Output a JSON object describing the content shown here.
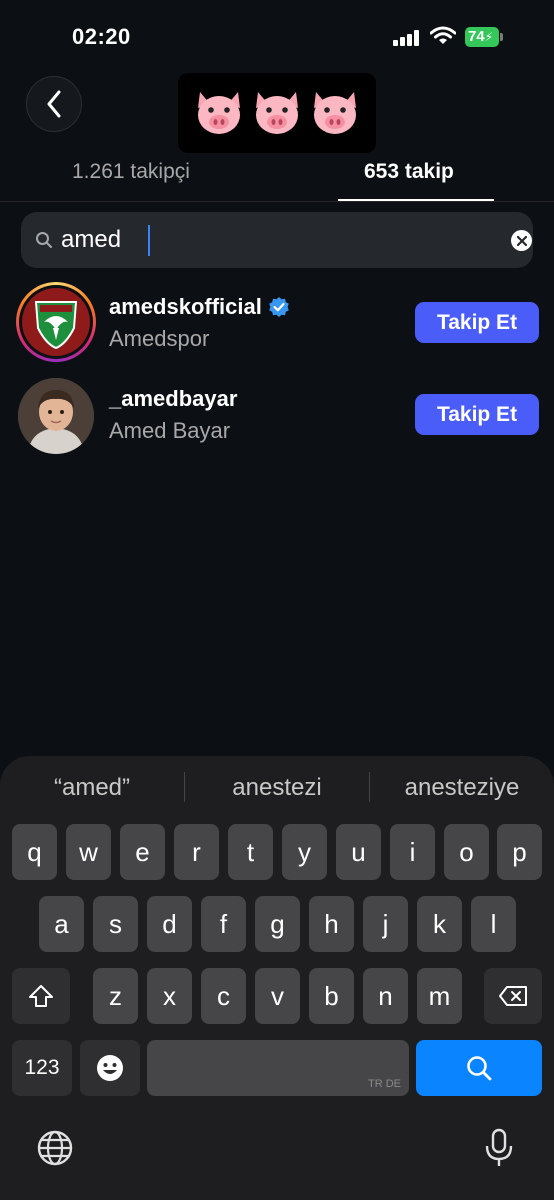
{
  "status_bar": {
    "time": "02:20",
    "battery": "74"
  },
  "header": {
    "title_emoji": [
      "🐷",
      "🐷",
      "🐷"
    ],
    "tabs": [
      {
        "label": "1.261 takipçi"
      },
      {
        "label": "653 takip"
      }
    ]
  },
  "search": {
    "value": "amed"
  },
  "results": [
    {
      "username": "amedskofficial",
      "full_name": "Amedspor",
      "verified": true,
      "button": "Takip Et"
    },
    {
      "username": "_amedbayar",
      "full_name": "Amed Bayar",
      "verified": false,
      "button": "Takip Et"
    }
  ],
  "keyboard": {
    "suggestions": [
      "“amed”",
      "anestezi",
      "anesteziye"
    ],
    "row1": [
      "q",
      "w",
      "e",
      "r",
      "t",
      "y",
      "u",
      "i",
      "o",
      "p"
    ],
    "row2": [
      "a",
      "s",
      "d",
      "f",
      "g",
      "h",
      "j",
      "k",
      "l"
    ],
    "row3": [
      "z",
      "x",
      "c",
      "v",
      "b",
      "n",
      "m"
    ],
    "numbers_key": "123",
    "space_lang": "TR DE"
  },
  "colors": {
    "follow_button": "#4a5df9",
    "verified_badge": "#3897f0",
    "keyboard_action": "#0a84ff"
  }
}
